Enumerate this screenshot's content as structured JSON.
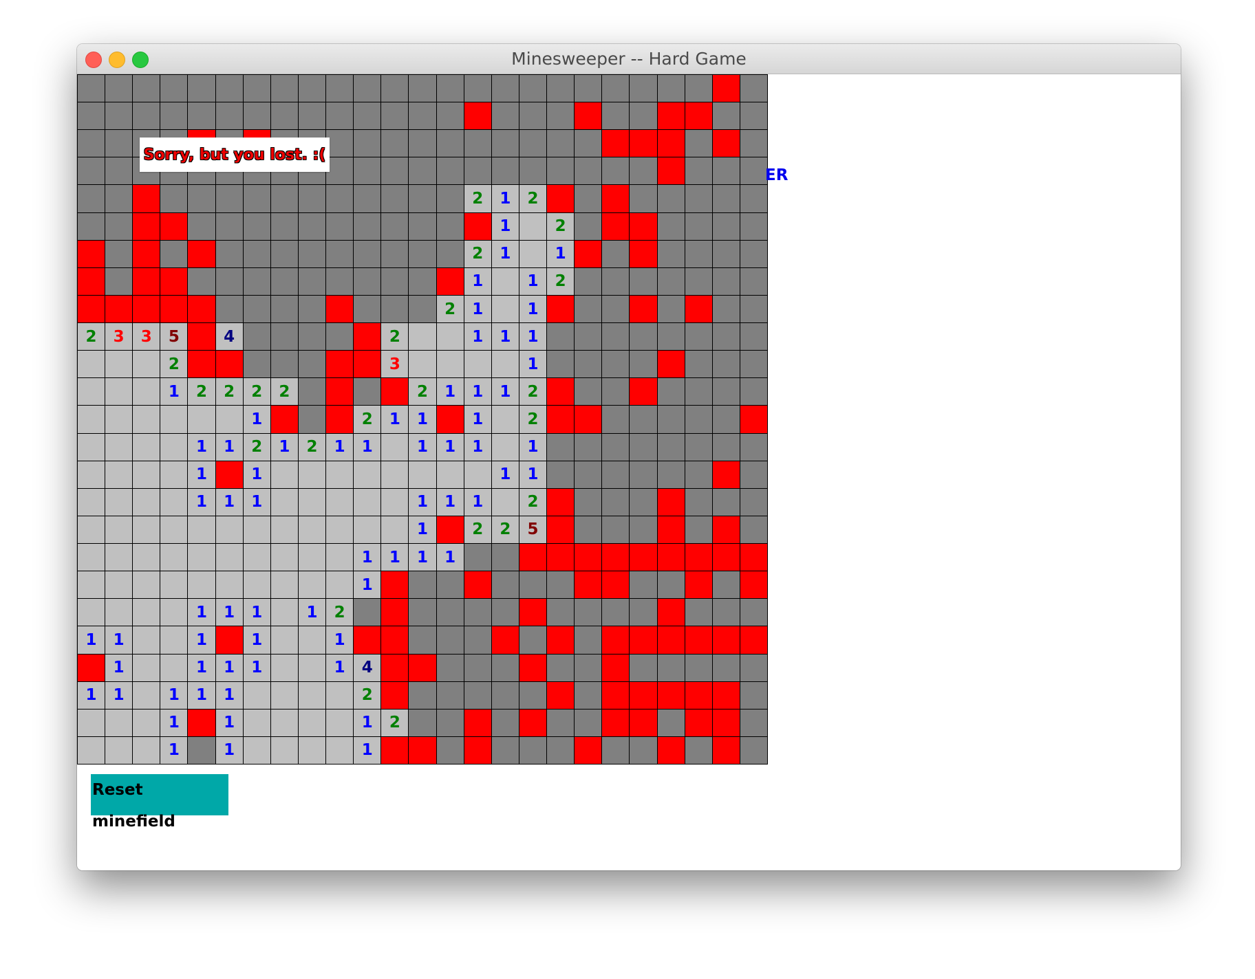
{
  "window": {
    "title": "Minesweeper -- Hard Game",
    "traffic_lights": {
      "close": "#ff5f57",
      "minimize": "#febc2e",
      "zoom": "#28c840"
    }
  },
  "message": {
    "lost_text": "Sorry, but you lost. :("
  },
  "side_label": {
    "text": "ER"
  },
  "controls": {
    "reset_label": "Reset minefield"
  },
  "board": {
    "size": 25,
    "colors": {
      "hidden": "#808080",
      "revealed": "#c0c0c0",
      "mine": "#ff0000",
      "n1": "#0000ff",
      "n2": "#008000",
      "n3": "#ff0000",
      "n4": "#000080",
      "n5": "#800000"
    },
    "legend": {
      "#": "hidden",
      ".": "revealed empty",
      "X": "mine",
      "1-9": "revealed number"
    },
    "rows": [
      "#######################X#X#",
      "##############X###X##XX##",
      "####X#X############XXX#X#X##",
      "#####################X####XX",
      "##X###########212X#X######X",
      "##XX##########X1.2#XX#####",
      "X#X#X#########21.1X#X#####",
      "X#XX#########X1.12#######",
      "XXXXX####X###21.1X##X#X##X#",
      "2335X4####X2..111########",
      "...2XX###XX3....1####X###",
      "...12222#X#X21112X##X####",
      "......1X#X211X1.2XX#####X",
      "....1121211.111.1########",
      "....1X1........11######X#",
      "....111.....111.2X###X###",
      "............1X225X###X#X#",
      "..........1111##XXXXXXXXX#X",
      "..........1X##X###XX##X#X##",
      "....111.12#X####X####X#",
      "11..1X1..1XX###X#X#XXXXXX",
      "X1..111..14XX###X##X#####",
      "11.111....2X#####X#XXXXX#",
      "...1X1....12##X#X##XX#XX#",
      "...1#1....1XX#X###X##X#X"
    ]
  }
}
